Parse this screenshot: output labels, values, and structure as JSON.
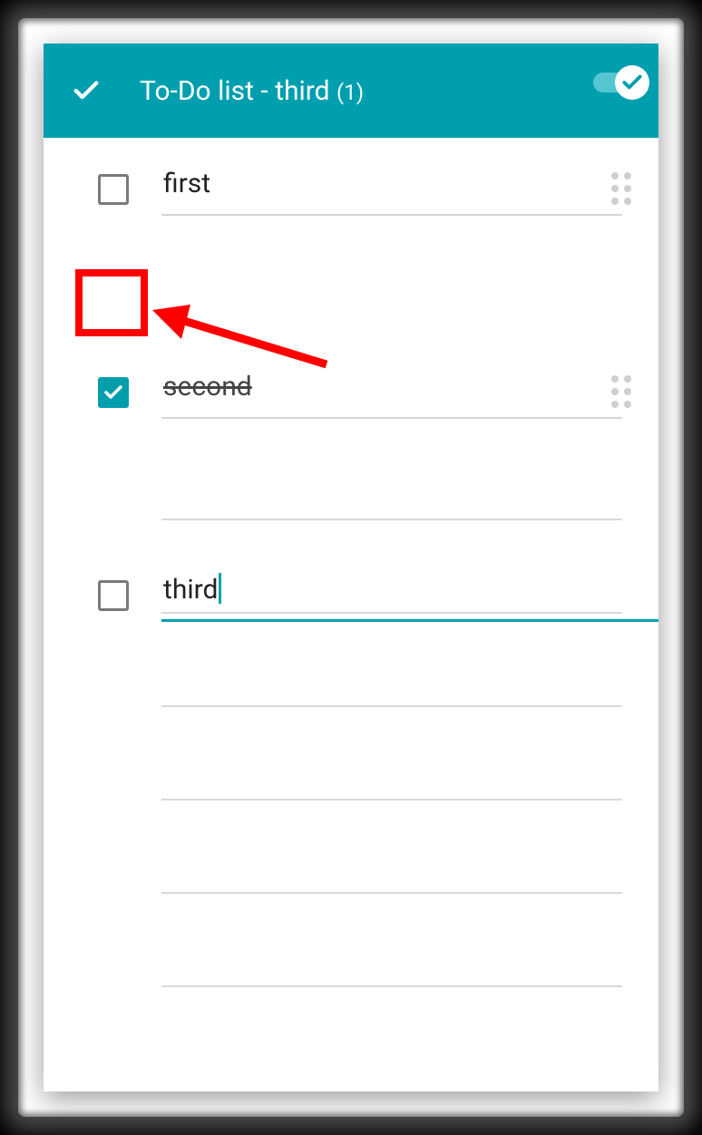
{
  "header": {
    "title_main": "To-Do list - third",
    "title_count": "(1)"
  },
  "items": [
    {
      "text": "first",
      "checked": false,
      "has_grip": true,
      "active": false
    },
    {
      "text": "second",
      "checked": true,
      "has_grip": true,
      "active": false
    },
    {
      "text": "third",
      "checked": false,
      "has_grip": false,
      "active": true
    }
  ],
  "colors": {
    "accent": "#009faf",
    "annotation": "#ff0000"
  }
}
